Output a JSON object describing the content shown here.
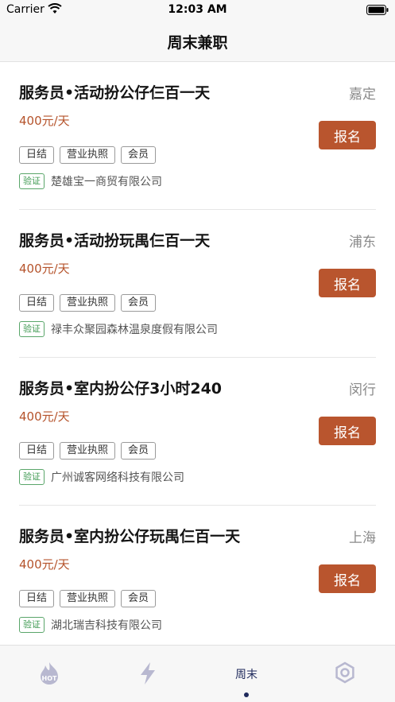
{
  "status_bar": {
    "carrier": "Carrier",
    "time": "12:03 AM"
  },
  "nav": {
    "title": "周末兼职"
  },
  "jobs": [
    {
      "title": "服务员•活动扮公仔仨百一天",
      "location": "嘉定",
      "salary": "400元/天",
      "apply_label": "报名",
      "tags": [
        "日结",
        "营业执照",
        "会员"
      ],
      "verify_label": "验证",
      "company": "楚雄宝一商贸有限公司"
    },
    {
      "title": "服务员•活动扮玩禺仨百一天",
      "location": "浦东",
      "salary": "400元/天",
      "apply_label": "报名",
      "tags": [
        "日结",
        "营业执照",
        "会员"
      ],
      "verify_label": "验证",
      "company": "禄丰众聚园森林温泉度假有限公司"
    },
    {
      "title": "服务员•室内扮公仔3小时240",
      "location": "闵行",
      "salary": "400元/天",
      "apply_label": "报名",
      "tags": [
        "日结",
        "营业执照",
        "会员"
      ],
      "verify_label": "验证",
      "company": "广州诚客网络科技有限公司"
    },
    {
      "title": "服务员•室内扮公仔玩禺仨百一天",
      "location": "上海",
      "salary": "400元/天",
      "apply_label": "报名",
      "tags": [
        "日结",
        "营业执照",
        "会员"
      ],
      "verify_label": "验证",
      "company": "湖北瑞吉科技有限公司"
    }
  ],
  "tab_bar": {
    "tabs": [
      {
        "icon": "hot-flame-icon",
        "badge_text": "HOT",
        "active": false
      },
      {
        "icon": "lightning-icon",
        "active": false
      },
      {
        "icon": "weekend-tab",
        "label": "周末",
        "active": true
      },
      {
        "icon": "gear-hexagon-icon",
        "active": false
      }
    ]
  },
  "colors": {
    "accent": "#b9552e",
    "salary": "#b5532b",
    "verify": "#3f9a52",
    "tab_active": "#1f2a5c",
    "tab_inactive": "#b8b8d0"
  }
}
